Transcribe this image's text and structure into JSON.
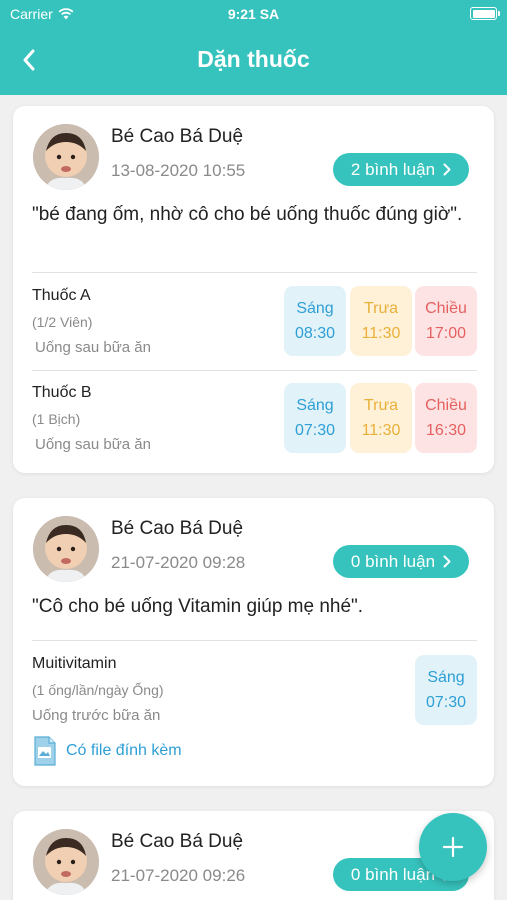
{
  "status": {
    "carrier": "Carrier",
    "time": "9:21 SA"
  },
  "header": {
    "title": "Dặn thuốc"
  },
  "colors": {
    "accent": "#37C3BD",
    "morning": "#2E9FD6",
    "noon": "#E8B038",
    "afternoon": "#E66060"
  },
  "posts": [
    {
      "author": "Bé Cao Bá Duệ",
      "datetime": "13-08-2020 10:55",
      "comments": "2 bình luận",
      "message": "\"bé đang ốm,  nhờ cô cho bé uống thuốc đúng giờ\".",
      "medicines": [
        {
          "name": "Thuốc A",
          "dose": "(1/2 Viên)",
          "note": "Uống sau bữa ăn",
          "slots": [
            {
              "label": "Sáng",
              "time": "08:30"
            },
            {
              "label": "Trưa",
              "time": "11:30"
            },
            {
              "label": "Chiều",
              "time": "17:00"
            }
          ]
        },
        {
          "name": "Thuốc B",
          "dose": "(1  Bịch)",
          "note": "Uống sau bữa ăn",
          "slots": [
            {
              "label": "Sáng",
              "time": "07:30"
            },
            {
              "label": "Trưa",
              "time": "11:30"
            },
            {
              "label": "Chiều",
              "time": "16:30"
            }
          ]
        }
      ]
    },
    {
      "author": "Bé Cao Bá Duệ",
      "datetime": "21-07-2020 09:28",
      "comments": "0 bình luận",
      "message": "\"Cô cho bé uống Vitamin giúp mẹ nhé\".",
      "medicines": [
        {
          "name": "Muitivitamin",
          "dose": "(1 ống/lần/ngày  Ống)",
          "note": "Uống trước bữa ăn",
          "slots": [
            {
              "label": "Sáng",
              "time": "07:30"
            }
          ]
        }
      ],
      "attachment": "Có file đính kèm"
    },
    {
      "author": "Bé Cao Bá Duệ",
      "datetime": "21-07-2020 09:26",
      "comments": "0 bình luận"
    }
  ],
  "icons": {
    "back": "chevron-left-icon",
    "wifi": "wifi-icon",
    "battery": "battery-icon",
    "comment_arrow": "chevron-right-icon",
    "attachment": "file-icon",
    "add": "plus-icon"
  }
}
